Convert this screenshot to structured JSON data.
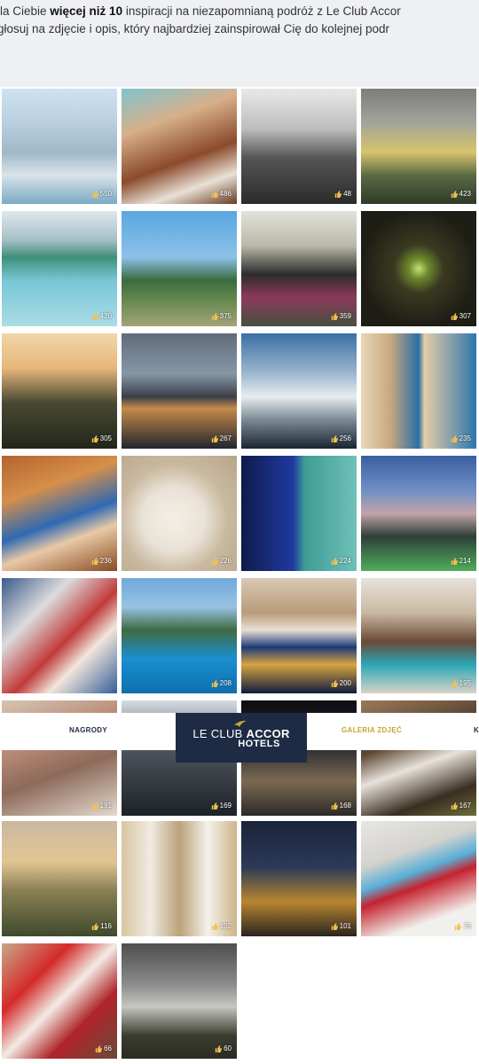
{
  "intro": {
    "line1_a": "lla Ciebie ",
    "line1_bold": "więcej niż 10",
    "line1_b": " inspiracji na niezapomnianą podróż z Le Club Accor",
    "line2": "głosuj na zdjęcie i opis, który najbardziej zainspirował Cię do kolejnej podr"
  },
  "nav": {
    "rewards": "NAGRODY",
    "gallery": "GALERIA ZDJĘĆ",
    "partial": "K",
    "logo_line1_a": "LE CLUB ",
    "logo_line1_b": "ACCOR",
    "logo_line2": "HOTELS"
  },
  "colors": {
    "accent_gold": "#c8a233",
    "logo_bg": "#1d2b45"
  },
  "photos": [
    {
      "likes": "550"
    },
    {
      "likes": "486"
    },
    {
      "likes": "48"
    },
    {
      "likes": "423"
    },
    {
      "likes": "420"
    },
    {
      "likes": "375"
    },
    {
      "likes": "359"
    },
    {
      "likes": "307"
    },
    {
      "likes": "305"
    },
    {
      "likes": "267"
    },
    {
      "likes": "256"
    },
    {
      "likes": "235"
    },
    {
      "likes": "236"
    },
    {
      "likes": "226"
    },
    {
      "likes": "224"
    },
    {
      "likes": "214"
    },
    {
      "likes": ""
    },
    {
      "likes": "208"
    },
    {
      "likes": "200"
    },
    {
      "likes": "195"
    },
    {
      "likes": "191"
    },
    {
      "likes": "169"
    },
    {
      "likes": "168"
    },
    {
      "likes": "167"
    },
    {
      "likes": "116"
    },
    {
      "likes": "102"
    },
    {
      "likes": "101"
    },
    {
      "likes": "76"
    },
    {
      "likes": "66"
    },
    {
      "likes": "60"
    }
  ]
}
